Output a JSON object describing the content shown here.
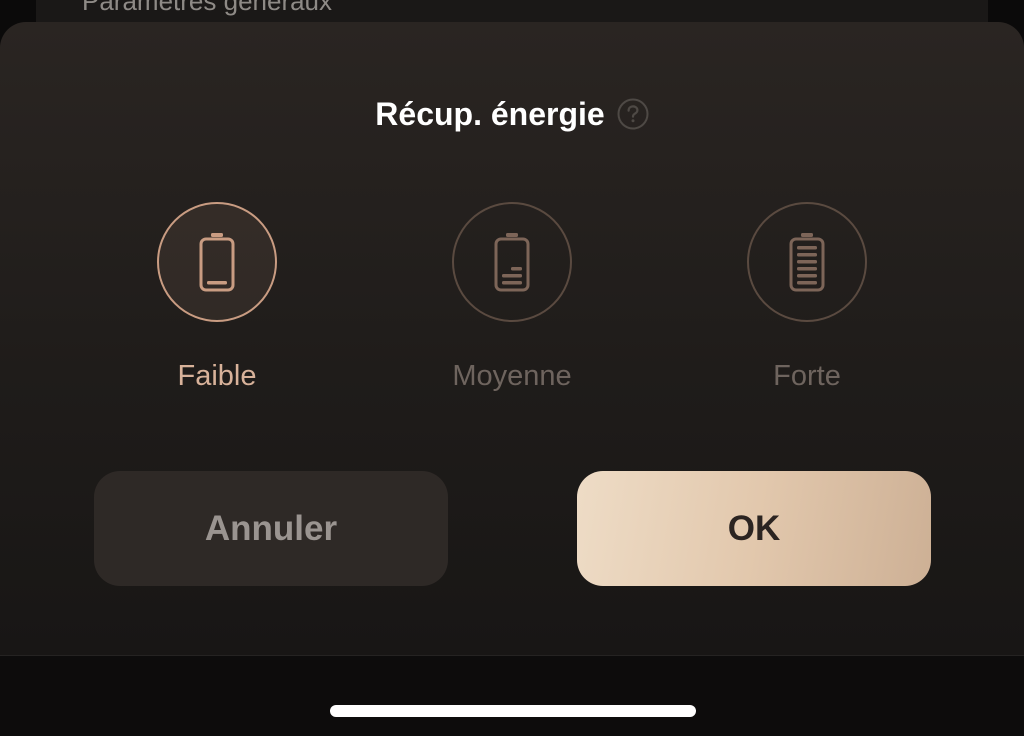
{
  "background_item": {
    "label": "Paramètres généraux"
  },
  "dialog": {
    "title": "Récup. énergie",
    "help_icon": "question-circle-icon",
    "selected_index": 0,
    "options": [
      {
        "label": "Faible",
        "icon": "battery-low-icon",
        "selected": true
      },
      {
        "label": "Moyenne",
        "icon": "battery-medium-icon",
        "selected": false
      },
      {
        "label": "Forte",
        "icon": "battery-full-icon",
        "selected": false
      }
    ],
    "buttons": {
      "cancel_label": "Annuler",
      "ok_label": "OK"
    }
  },
  "colors": {
    "accent": "#c99c82",
    "accent_text": "#d8b29a",
    "muted": "#6e645e",
    "ok_button": "#e2c8ad",
    "cancel_button": "#2e2926"
  }
}
